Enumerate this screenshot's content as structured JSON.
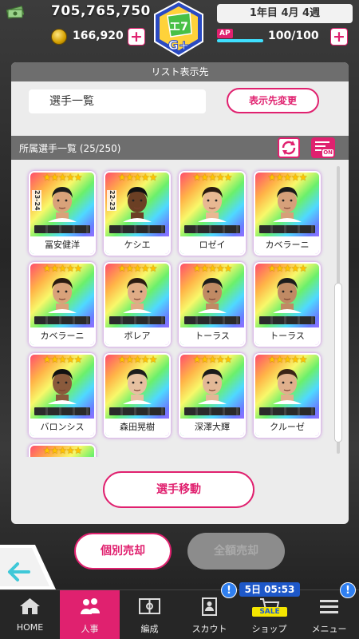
{
  "status": {
    "money": "705,765,750",
    "coins": "166,920",
    "date": "1年目 4月 4週",
    "ap_label": "AP",
    "ap": "100/100",
    "ap_fraction": 1.0
  },
  "emblem": {
    "text": "G+"
  },
  "list_dest": {
    "header": "リスト表示先",
    "value": "選手一覧",
    "change_label": "表示先変更"
  },
  "roster": {
    "title": "所属選手一覧 (25/250)",
    "filter_on": "ON",
    "players": [
      {
        "name": "冨安健洋",
        "age": "23-24"
      },
      {
        "name": "ケシエ",
        "age": "22-23"
      },
      {
        "name": "ロゼイ",
        "age": ""
      },
      {
        "name": "カベラーニ",
        "age": ""
      },
      {
        "name": "カベラーニ",
        "age": ""
      },
      {
        "name": "ボレア",
        "age": ""
      },
      {
        "name": "トーラス",
        "age": ""
      },
      {
        "name": "トーラス",
        "age": ""
      },
      {
        "name": "バロンシス",
        "age": ""
      },
      {
        "name": "森田晃樹",
        "age": ""
      },
      {
        "name": "深澤大輝",
        "age": ""
      },
      {
        "name": "クルーゼ",
        "age": ""
      }
    ],
    "move_label": "選手移動"
  },
  "actions": {
    "sell_single": "個別売却",
    "sell_all": "全額売却"
  },
  "nav": {
    "items": [
      {
        "label": "HOME",
        "icon": "home-icon"
      },
      {
        "label": "人事",
        "icon": "people-icon"
      },
      {
        "label": "編成",
        "icon": "pitch-icon"
      },
      {
        "label": "スカウト",
        "icon": "scout-icon"
      },
      {
        "label": "ショップ",
        "icon": "cart-icon"
      },
      {
        "label": "メニュー",
        "icon": "menu-icon"
      }
    ],
    "badge": "!",
    "sale_timer": "5日 05:53",
    "sale_tag": "SALE"
  },
  "colors": {
    "accent": "#e0216f",
    "panel": "#ececec",
    "nav_active": "#e0216f",
    "badge": "#2f7ff0"
  }
}
